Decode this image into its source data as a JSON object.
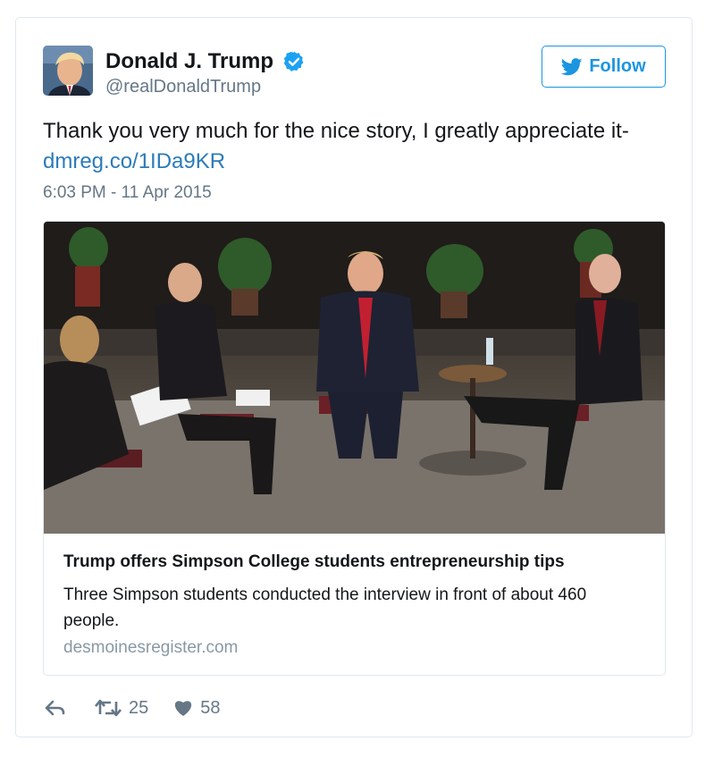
{
  "user": {
    "display_name": "Donald J. Trump",
    "handle": "@realDonaldTrump",
    "verified": true,
    "avatar_icon": "profile-photo"
  },
  "follow_button": {
    "label": "Follow",
    "icon": "twitter-bird-icon"
  },
  "tweet": {
    "text": "Thank you very much for the nice story, I greatly appreciate it-",
    "link": "dmreg.co/1IDa9KR",
    "timestamp": "6:03 PM - 11 Apr 2015"
  },
  "card": {
    "image_icon": "event-photo",
    "title": "Trump offers Simpson College students entrepreneurship tips",
    "description": "Three Simpson students conducted the interview in front of about 460 people.",
    "domain": "desmoinesregister.com"
  },
  "actions": {
    "reply_icon": "reply-icon",
    "retweet_icon": "retweet-icon",
    "retweet_count": "25",
    "like_icon": "heart-icon",
    "like_count": "58"
  },
  "colors": {
    "accent": "#1b95e0",
    "link": "#2b7bb9",
    "text": "#14171a",
    "muted": "#657786",
    "border": "#e1e8ed"
  }
}
